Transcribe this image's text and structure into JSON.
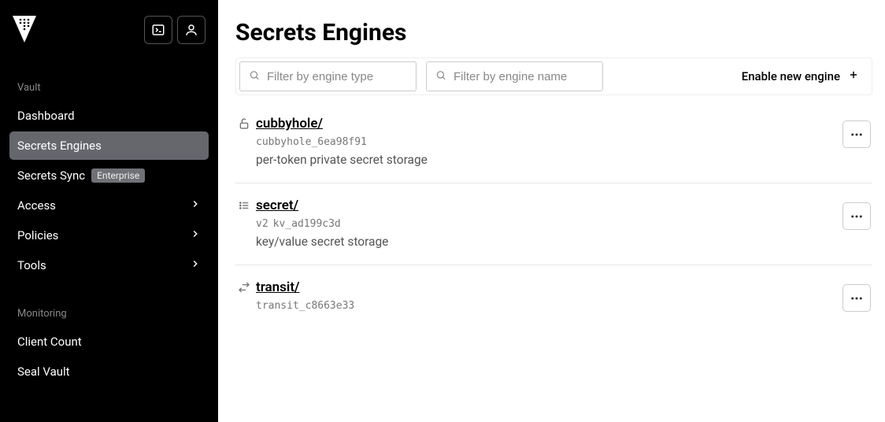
{
  "sidebar": {
    "section1_label": "Vault",
    "section2_label": "Monitoring",
    "items": [
      {
        "label": "Dashboard",
        "has_chevron": false,
        "active": false
      },
      {
        "label": "Secrets Engines",
        "has_chevron": false,
        "active": true
      },
      {
        "label": "Secrets Sync",
        "badge": "Enterprise",
        "has_chevron": false,
        "active": false
      },
      {
        "label": "Access",
        "has_chevron": true,
        "active": false
      },
      {
        "label": "Policies",
        "has_chevron": true,
        "active": false
      },
      {
        "label": "Tools",
        "has_chevron": true,
        "active": false
      }
    ],
    "monitoring_items": [
      {
        "label": "Client Count"
      },
      {
        "label": "Seal Vault"
      }
    ]
  },
  "page": {
    "title": "Secrets Engines",
    "filter_type_placeholder": "Filter by engine type",
    "filter_name_placeholder": "Filter by engine name",
    "enable_label": "Enable new engine"
  },
  "engines": [
    {
      "name": "cubbyhole/",
      "id": "cubbyhole_6ea98f91",
      "version": "",
      "description": "per-token private secret storage",
      "icon": "lock"
    },
    {
      "name": "secret/",
      "id": "kv_ad199c3d",
      "version": "v2",
      "description": "key/value secret storage",
      "icon": "list"
    },
    {
      "name": "transit/",
      "id": "transit_c8663e33",
      "version": "",
      "description": "",
      "icon": "swap"
    }
  ]
}
